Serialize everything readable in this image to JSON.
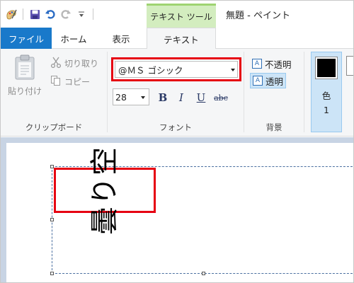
{
  "window": {
    "title": "無題 - ペイント",
    "context_tab_header": "テキスト ツール"
  },
  "tabs": [
    {
      "label": "ファイル"
    },
    {
      "label": "ホーム"
    },
    {
      "label": "表示"
    },
    {
      "label": "テキスト"
    }
  ],
  "clipboard": {
    "paste_label": "貼り付け",
    "cut_label": "切り取り",
    "copy_label": "コピー",
    "group_label": "クリップボード"
  },
  "font": {
    "family": "@ＭＳ ゴシック",
    "size": "28",
    "bold_label": "B",
    "italic_label": "I",
    "underline_label": "U",
    "strike_label": "abc",
    "group_label": "フォント"
  },
  "background": {
    "opaque_label": "不透明",
    "transparent_label": "透明",
    "selected": "transparent",
    "group_label": "背景"
  },
  "colors": {
    "color1_label_line1": "色",
    "color1_label_line2": "1",
    "color1_value": "#000000"
  },
  "canvas": {
    "text": "曇り空"
  }
}
